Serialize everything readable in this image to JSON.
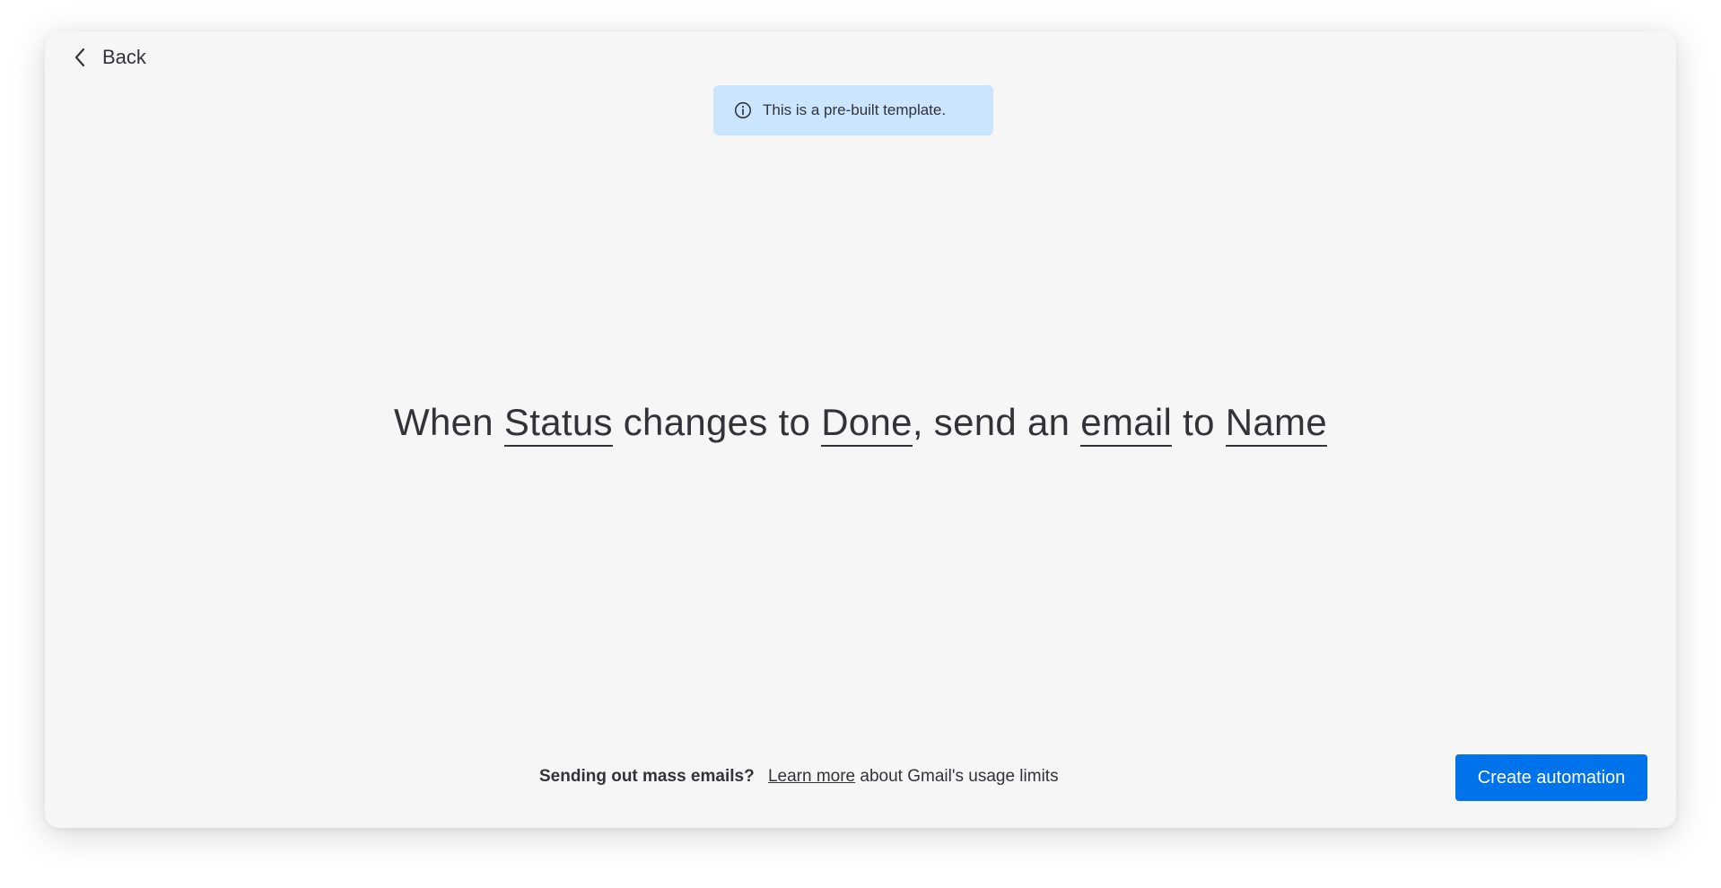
{
  "back": {
    "label": "Back",
    "icon": "chevron-left-icon"
  },
  "banner": {
    "text": "This is a pre-built template.",
    "icon": "info-icon",
    "background": "#cce5ff"
  },
  "sentence": {
    "parts": [
      {
        "text": "When ",
        "token": false
      },
      {
        "text": "Status",
        "token": true
      },
      {
        "text": " changes to ",
        "token": false
      },
      {
        "text": "Done",
        "token": true
      },
      {
        "text": ", send an ",
        "token": false
      },
      {
        "text": "email",
        "token": true
      },
      {
        "text": " to ",
        "token": false
      },
      {
        "text": "Name",
        "token": true
      }
    ]
  },
  "footer": {
    "bold_text": "Sending out mass emails?",
    "link_text": "Learn more",
    "trailing_text": "about Gmail's usage limits"
  },
  "actions": {
    "create_label": "Create automation",
    "accent_color": "#0073ea"
  }
}
